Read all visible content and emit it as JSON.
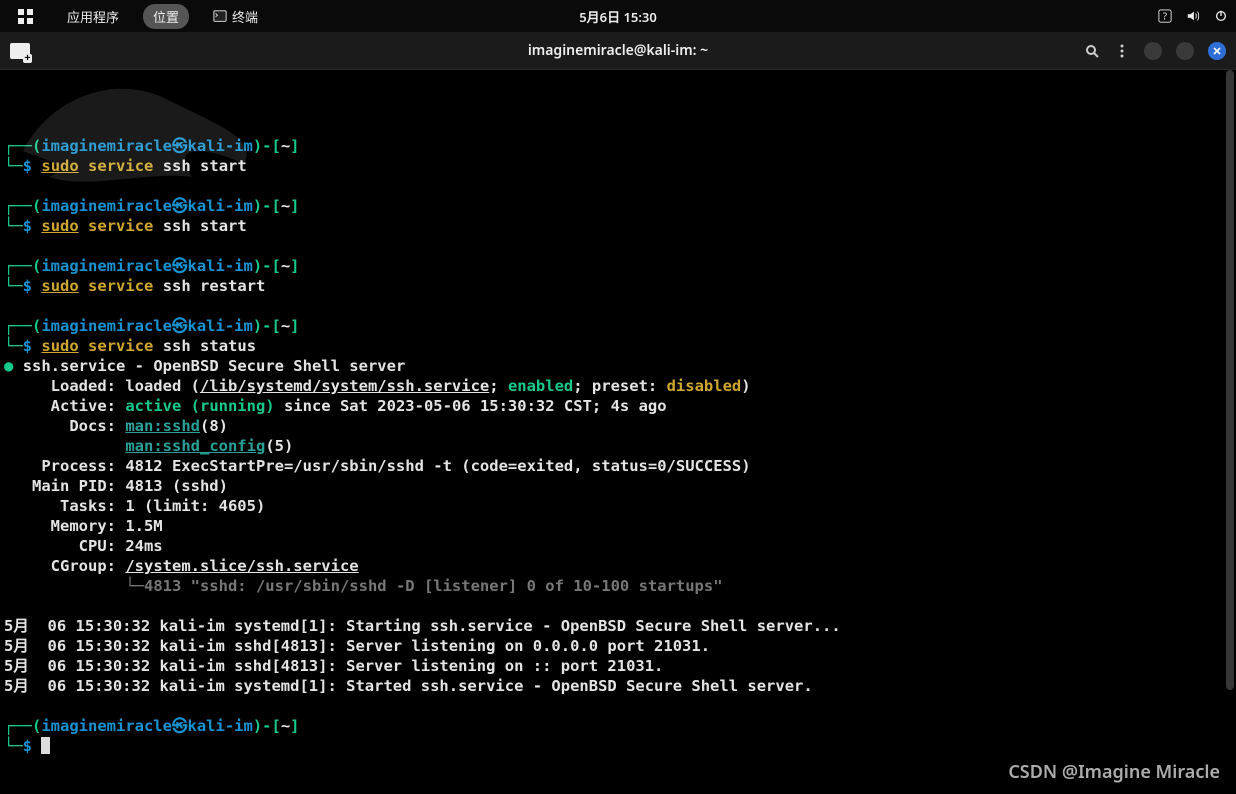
{
  "panel": {
    "apps_label": "应用程序",
    "places_label": "位置",
    "terminal_label": "终端",
    "clock": "5月6日  15:30"
  },
  "window": {
    "title": "imaginemiracle@kali-im: ~"
  },
  "prompt": {
    "user": "imaginemiracle",
    "host": "kali-im",
    "dir": "~",
    "sigil": "$"
  },
  "commands": {
    "sudo": "sudo",
    "service": "service",
    "ssh_start": "ssh start",
    "ssh_restart": "ssh restart",
    "ssh_status": "ssh status"
  },
  "status": {
    "header": "ssh.service - OpenBSD Secure Shell server",
    "loaded_label": "     Loaded: loaded (",
    "loaded_path": "/lib/systemd/system/ssh.service",
    "loaded_mid1": "; ",
    "enabled": "enabled",
    "loaded_mid2": "; preset: ",
    "disabled": "disabled",
    "loaded_end": ")",
    "active_label": "     Active: ",
    "active_val": "active (running)",
    "active_since": " since Sat 2023-05-06 15:30:32 CST; 4s ago",
    "docs_label": "       Docs: ",
    "docs1": "man:sshd",
    "docs1s": "(8)",
    "docs2_pad": "             ",
    "docs2": "man:sshd_config",
    "docs2s": "(5)",
    "process": "    Process: 4812 ExecStartPre=/usr/sbin/sshd -t (code=exited, status=0/SUCCESS)",
    "mainpid": "   Main PID: 4813 (sshd)",
    "tasks": "      Tasks: 1 (limit: 4605)",
    "memory": "     Memory: 1.5M",
    "cpu": "        CPU: 24ms",
    "cgroup_l": "     CGroup: ",
    "cgroup_p": "/system.slice/ssh.service",
    "cgroup_child": "4813 \"sshd: /usr/sbin/sshd -D [listener] 0 of 10-100 startups\"",
    "log1": "5月  06 15:30:32 kali-im systemd[1]: Starting ssh.service - OpenBSD Secure Shell server...",
    "log2": "5月  06 15:30:32 kali-im sshd[4813]: Server listening on 0.0.0.0 port 21031.",
    "log3": "5月  06 15:30:32 kali-im sshd[4813]: Server listening on :: port 21031.",
    "log4": "5月  06 15:30:32 kali-im systemd[1]: Started ssh.service - OpenBSD Secure Shell server."
  },
  "watermark": "CSDN @Imagine Miracle"
}
